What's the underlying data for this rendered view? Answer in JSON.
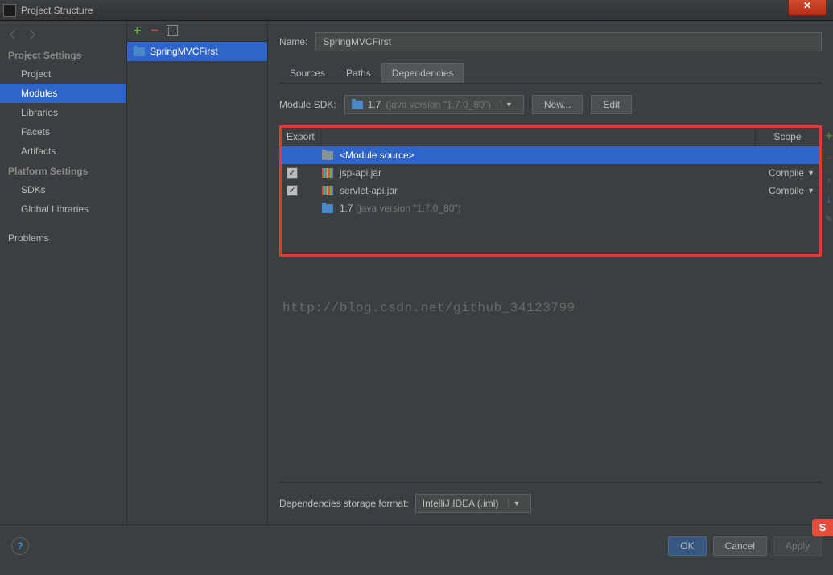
{
  "window": {
    "title": "Project Structure"
  },
  "sidebar": {
    "sections": [
      {
        "title": "Project Settings",
        "items": [
          "Project",
          "Modules",
          "Libraries",
          "Facets",
          "Artifacts"
        ],
        "selected": 1
      },
      {
        "title": "Platform Settings",
        "items": [
          "SDKs",
          "Global Libraries"
        ]
      },
      {
        "title": "",
        "items": [
          "Problems"
        ]
      }
    ]
  },
  "modules": {
    "items": [
      "SpringMVCFirst"
    ],
    "selected": 0
  },
  "name": {
    "label": "Name:",
    "value": "SpringMVCFirst"
  },
  "tabs": {
    "items": [
      "Sources",
      "Paths",
      "Dependencies"
    ],
    "active": 2
  },
  "sdk": {
    "label": "Module SDK:",
    "selected": "1.7",
    "detail": "(java version \"1.7.0_80\")",
    "new": "New...",
    "edit": "Edit"
  },
  "deps": {
    "headers": {
      "export": "Export",
      "scope": "Scope"
    },
    "rows": [
      {
        "checked": null,
        "icon": "folder",
        "name": "<Module source>",
        "detail": "",
        "scope": "",
        "sel": true
      },
      {
        "checked": true,
        "icon": "lib",
        "name": "jsp-api.jar",
        "detail": "",
        "scope": "Compile"
      },
      {
        "checked": true,
        "icon": "lib",
        "name": "servlet-api.jar",
        "detail": "",
        "scope": "Compile"
      },
      {
        "checked": null,
        "icon": "folder-blue",
        "name": "1.7",
        "detail": "(java version \"1.7.0_80\")",
        "scope": ""
      }
    ]
  },
  "watermark": "http://blog.csdn.net/github_34123799",
  "storage": {
    "label": "Dependencies storage format:",
    "value": "IntelliJ IDEA (.iml)"
  },
  "footer": {
    "ok": "OK",
    "cancel": "Cancel",
    "apply": "Apply",
    "help": "?"
  },
  "badge": "S"
}
